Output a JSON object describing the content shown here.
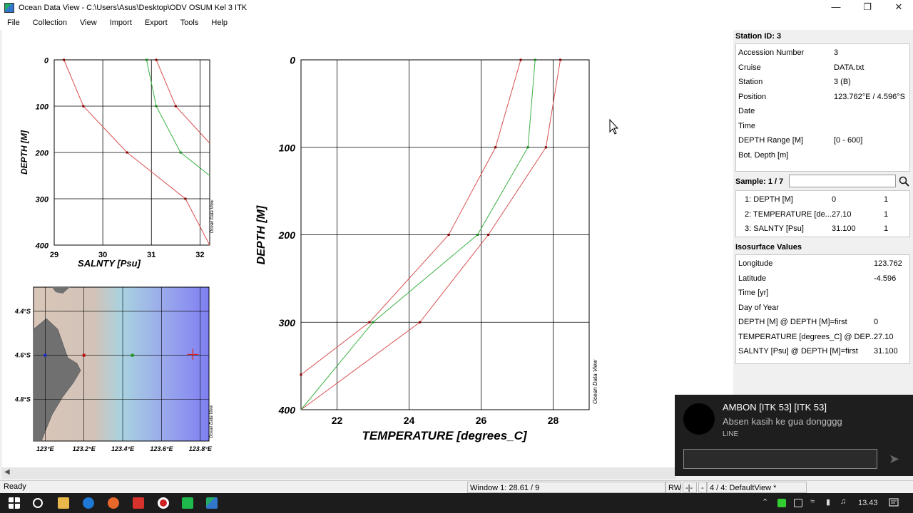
{
  "window": {
    "title": "Ocean Data View - C:\\Users\\Asus\\Desktop\\ODV OSUM Kel 3 ITK",
    "minimize": "—",
    "maximize": "❐",
    "close": "✕"
  },
  "menu": [
    "File",
    "Collection",
    "View",
    "Import",
    "Export",
    "Tools",
    "Help"
  ],
  "station_panel": {
    "header": "Station ID: 3",
    "rows": [
      {
        "label": "Accession Number",
        "value": "3"
      },
      {
        "label": "Cruise",
        "value": "DATA.txt"
      },
      {
        "label": "Station",
        "value": "3 (B)"
      },
      {
        "label": "Position",
        "value": "123.762°E / 4.596°S"
      },
      {
        "label": "Date",
        "value": ""
      },
      {
        "label": "Time",
        "value": ""
      },
      {
        "label": "DEPTH Range [M]",
        "value": "[0 - 600]"
      },
      {
        "label": "Bot. Depth [m]",
        "value": ""
      }
    ]
  },
  "sample_panel": {
    "header": "Sample: 1 / 7",
    "search_value": "",
    "rows": [
      {
        "label": "1: DEPTH [M]",
        "value": "0",
        "flag": "1"
      },
      {
        "label": "2: TEMPERATURE [de...",
        "value": "27.10",
        "flag": "1"
      },
      {
        "label": "3: SALNTY [Psu]",
        "value": "31.100",
        "flag": "1"
      }
    ]
  },
  "isosurface_panel": {
    "header": "Isosurface Values",
    "rows": [
      {
        "label": "Longitude",
        "value": "123.762"
      },
      {
        "label": "Latitude",
        "value": "-4.596"
      },
      {
        "label": "Time [yr]",
        "value": ""
      },
      {
        "label": "Day of Year",
        "value": ""
      },
      {
        "label": "DEPTH [M] @ DEPTH [M]=first",
        "value": "0"
      },
      {
        "label": "TEMPERATURE [degrees_C] @ DEP...",
        "value": "27.10"
      },
      {
        "label": "SALNTY [Psu] @ DEPTH [M]=first",
        "value": "31.100"
      }
    ]
  },
  "status": {
    "left": "Ready",
    "window": "Window 1:  28.61 / 9",
    "rw": "RW",
    "c2": "-|-",
    "c3": "-",
    "view": "4 / 4: DefaultView *"
  },
  "toast": {
    "title": "AMBON [ITK 53] [ITK 53]",
    "message": "Absen kasih ke gua dongggg",
    "app": "LINE",
    "reply_placeholder": ""
  },
  "taskbar": {
    "time": "13.43"
  },
  "colors": {
    "profile_red": "#d85050",
    "profile_green": "#3cb043",
    "marker_dark": "#8b0000",
    "land": "#707070",
    "sea_warm": "#d9c6b8",
    "sea_cold": "#8080f0"
  },
  "chart_data": [
    {
      "type": "line",
      "xlabel": "SALNTY [Psu]",
      "ylabel": "DEPTH [M]",
      "xlim": [
        29,
        32.2
      ],
      "ylim": [
        400,
        0
      ],
      "xticks": [
        "29",
        "30",
        "31",
        "32"
      ],
      "yticks": [
        "0",
        "100",
        "200",
        "300",
        "400"
      ],
      "side_label": "Ocean Data View",
      "series": [
        {
          "x": [
            29.2,
            29.6,
            30.5,
            31.7,
            32.2
          ],
          "y": [
            0,
            100,
            200,
            300,
            400
          ],
          "color": "red"
        },
        {
          "x": [
            30.9,
            31.1,
            31.6,
            32.2
          ],
          "y": [
            0,
            100,
            200,
            250
          ],
          "color": "green"
        },
        {
          "x": [
            31.1,
            31.5,
            32.2
          ],
          "y": [
            0,
            100,
            180
          ],
          "color": "red"
        }
      ]
    },
    {
      "type": "line",
      "xlabel": "TEMPERATURE [degrees_C]",
      "ylabel": "DEPTH [M]",
      "xlim": [
        21,
        29
      ],
      "ylim": [
        400,
        0
      ],
      "xticks": [
        "22",
        "24",
        "26",
        "28"
      ],
      "yticks": [
        "0",
        "100",
        "200",
        "300",
        "400"
      ],
      "side_label": "Ocean Data View",
      "series": [
        {
          "x": [
            28.2,
            27.8,
            26.2,
            24.3,
            21.0
          ],
          "y": [
            0,
            100,
            200,
            300,
            400
          ],
          "color": "red"
        },
        {
          "x": [
            27.5,
            27.3,
            25.9,
            23.0,
            21.0
          ],
          "y": [
            0,
            100,
            200,
            300,
            400
          ],
          "color": "green"
        },
        {
          "x": [
            27.1,
            26.4,
            25.1,
            22.9,
            21.0
          ],
          "y": [
            0,
            100,
            200,
            300,
            360
          ],
          "color": "red"
        }
      ]
    },
    {
      "type": "heatmap",
      "xticks": [
        "123°E",
        "123.2°E",
        "123.4°E",
        "123.6°E",
        "123.8°E"
      ],
      "yticks": [
        "4.4°S",
        "4.6°S",
        "4.8°S"
      ],
      "side_label": "Ocean Data View",
      "stations": [
        {
          "lon": 123.0,
          "lat": -4.6,
          "color": "blue"
        },
        {
          "lon": 123.2,
          "lat": -4.6,
          "color": "red"
        },
        {
          "lon": 123.45,
          "lat": -4.6,
          "color": "green"
        },
        {
          "lon": 123.762,
          "lat": -4.596,
          "color": "red-cross"
        }
      ]
    }
  ]
}
